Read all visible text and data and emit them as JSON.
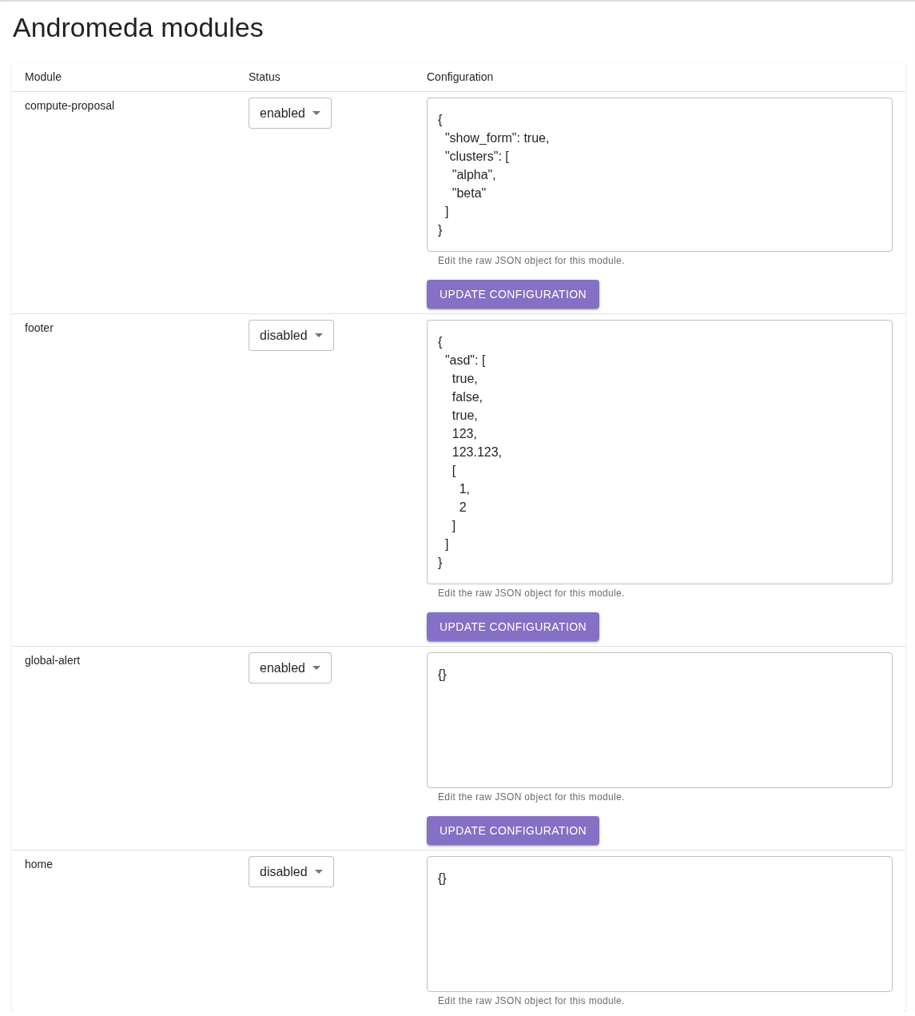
{
  "page": {
    "title": "Andromeda modules"
  },
  "table": {
    "columns": [
      "Module",
      "Status",
      "Configuration"
    ],
    "rows": [
      {
        "module": "compute-proposal",
        "status": "enabled",
        "configuration": "{\n  \"show_form\": true,\n  \"clusters\": [\n    \"alpha\",\n    \"beta\"\n  ]\n}",
        "helper_text": "Edit the raw JSON object for this module.",
        "button": "UPDATE CONFIGURATION"
      },
      {
        "module": "footer",
        "status": "disabled",
        "configuration": "{\n  \"asd\": [\n    true,\n    false,\n    true,\n    123,\n    123.123,\n    [\n      1,\n      2\n    ]\n  ]\n}",
        "helper_text": "Edit the raw JSON object for this module.",
        "button": "UPDATE CONFIGURATION"
      },
      {
        "module": "global-alert",
        "status": "enabled",
        "configuration": "{}",
        "helper_text": "Edit the raw JSON object for this module.",
        "button": "UPDATE CONFIGURATION"
      },
      {
        "module": "home",
        "status": "disabled",
        "configuration": "{}",
        "helper_text": "Edit the raw JSON object for this module."
      }
    ]
  }
}
